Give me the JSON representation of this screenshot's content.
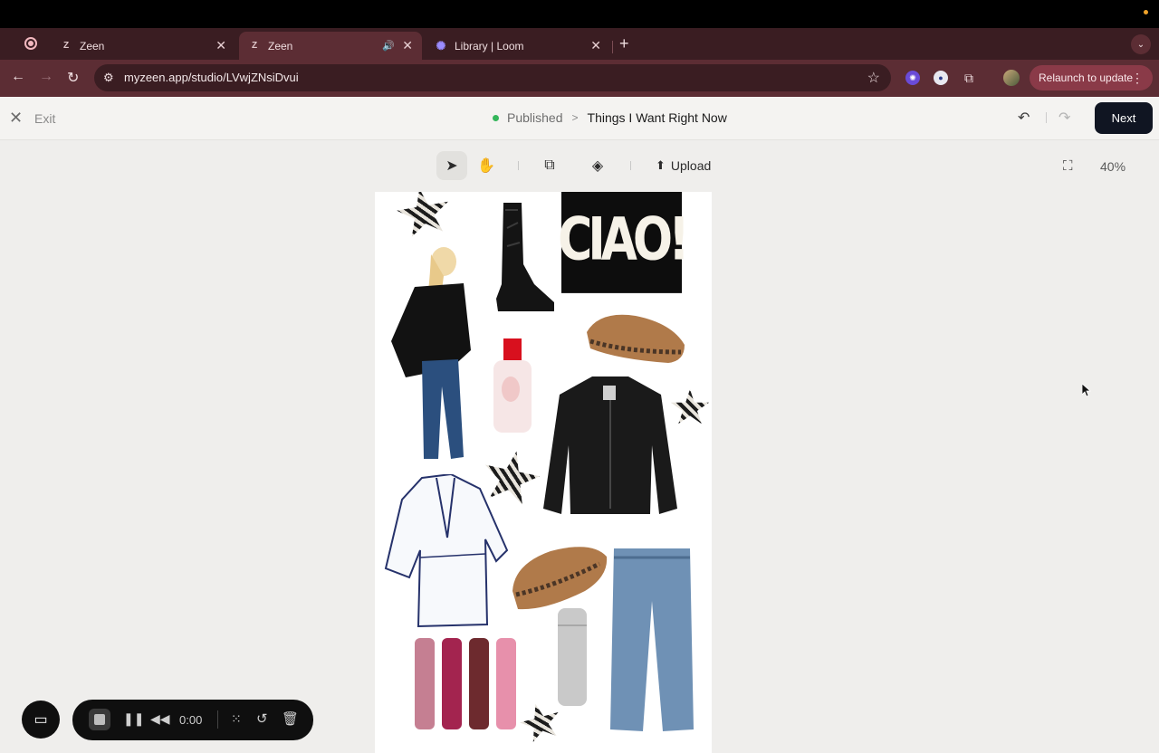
{
  "browser": {
    "tabs": [
      {
        "label": "Zeen",
        "favicon": "zeen-icon"
      },
      {
        "label": "Zeen",
        "favicon": "zeen-icon",
        "active": true,
        "audio": true
      },
      {
        "label": "Library | Loom",
        "favicon": "loom-icon"
      }
    ],
    "url": "myzeen.app/studio/LVwjZNsiDvui",
    "relaunch_label": "Relaunch to update"
  },
  "app": {
    "exit_label": "Exit",
    "status": "Published",
    "doc_title": "Things I Want Right Now",
    "next_label": "Next",
    "upload_label": "Upload",
    "zoom": "40%",
    "status_color": "#34b65a",
    "accent": "#101522"
  },
  "canvas": {
    "ciao_text": "CIAO!"
  },
  "recorder": {
    "time": "0:00"
  }
}
